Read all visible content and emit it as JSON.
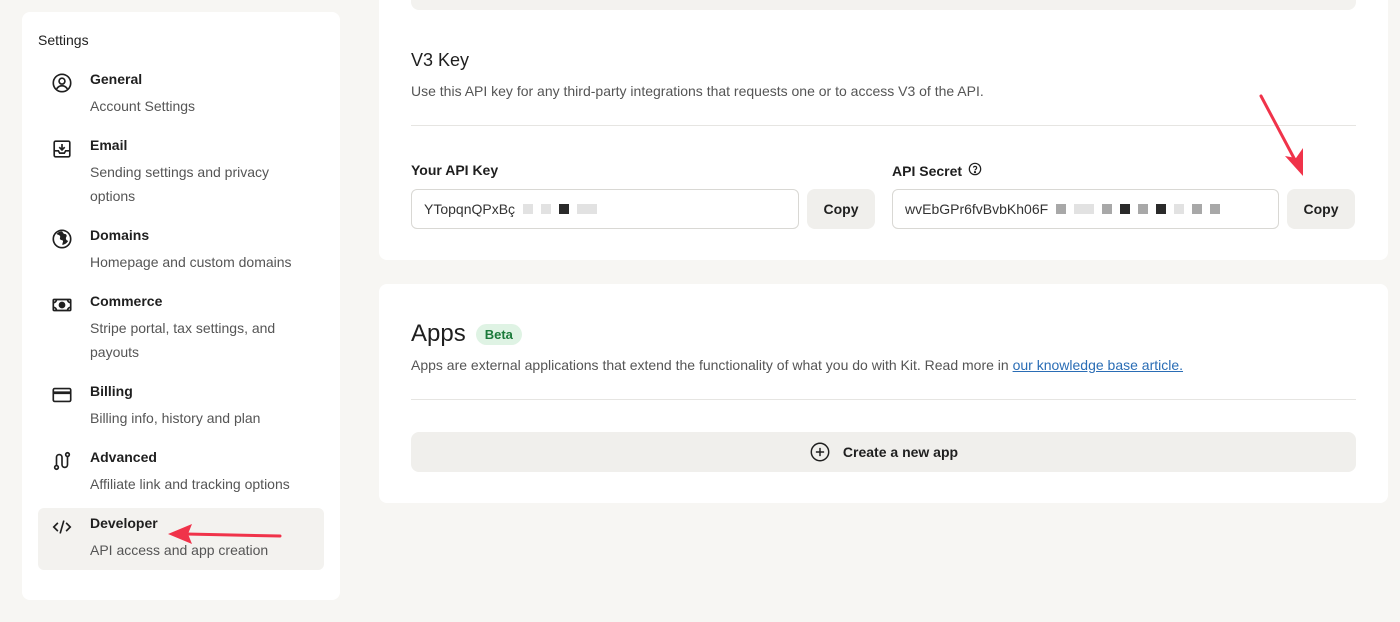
{
  "sidebar": {
    "title": "Settings",
    "items": [
      {
        "label": "General",
        "sub": "Account Settings",
        "icon": "user-circle-icon"
      },
      {
        "label": "Email",
        "sub": "Sending settings and privacy options",
        "icon": "inbox-download-icon"
      },
      {
        "label": "Domains",
        "sub": "Homepage and custom domains",
        "icon": "globe-icon"
      },
      {
        "label": "Commerce",
        "sub": "Stripe portal, tax settings, and payouts",
        "icon": "banknote-icon"
      },
      {
        "label": "Billing",
        "sub": "Billing info, history and plan",
        "icon": "credit-card-icon"
      },
      {
        "label": "Advanced",
        "sub": "Affiliate link and tracking options",
        "icon": "route-icon"
      },
      {
        "label": "Developer",
        "sub": "API access and app creation",
        "icon": "code-icon",
        "active": true
      }
    ]
  },
  "v3key": {
    "title": "V3 Key",
    "description": "Use this API key for any third-party integrations that requests one or to access V3 of the API.",
    "api_key_label": "Your API Key",
    "api_key_value": "YTopqnQPxBç",
    "api_secret_label": "API Secret",
    "api_secret_value": "wvEbGPr6fvBvbKh06F",
    "copy_label": "Copy"
  },
  "apps": {
    "title": "Apps",
    "badge": "Beta",
    "description": "Apps are external applications that extend the functionality of what you do with Kit. Read more in ",
    "link_text": "our knowledge base article.",
    "create_label": "Create a new app"
  },
  "colors": {
    "accent_arrow": "#f0334a",
    "beta_text": "#1b7a3a",
    "beta_bg": "#dff3e4",
    "link": "#2a6db5"
  }
}
